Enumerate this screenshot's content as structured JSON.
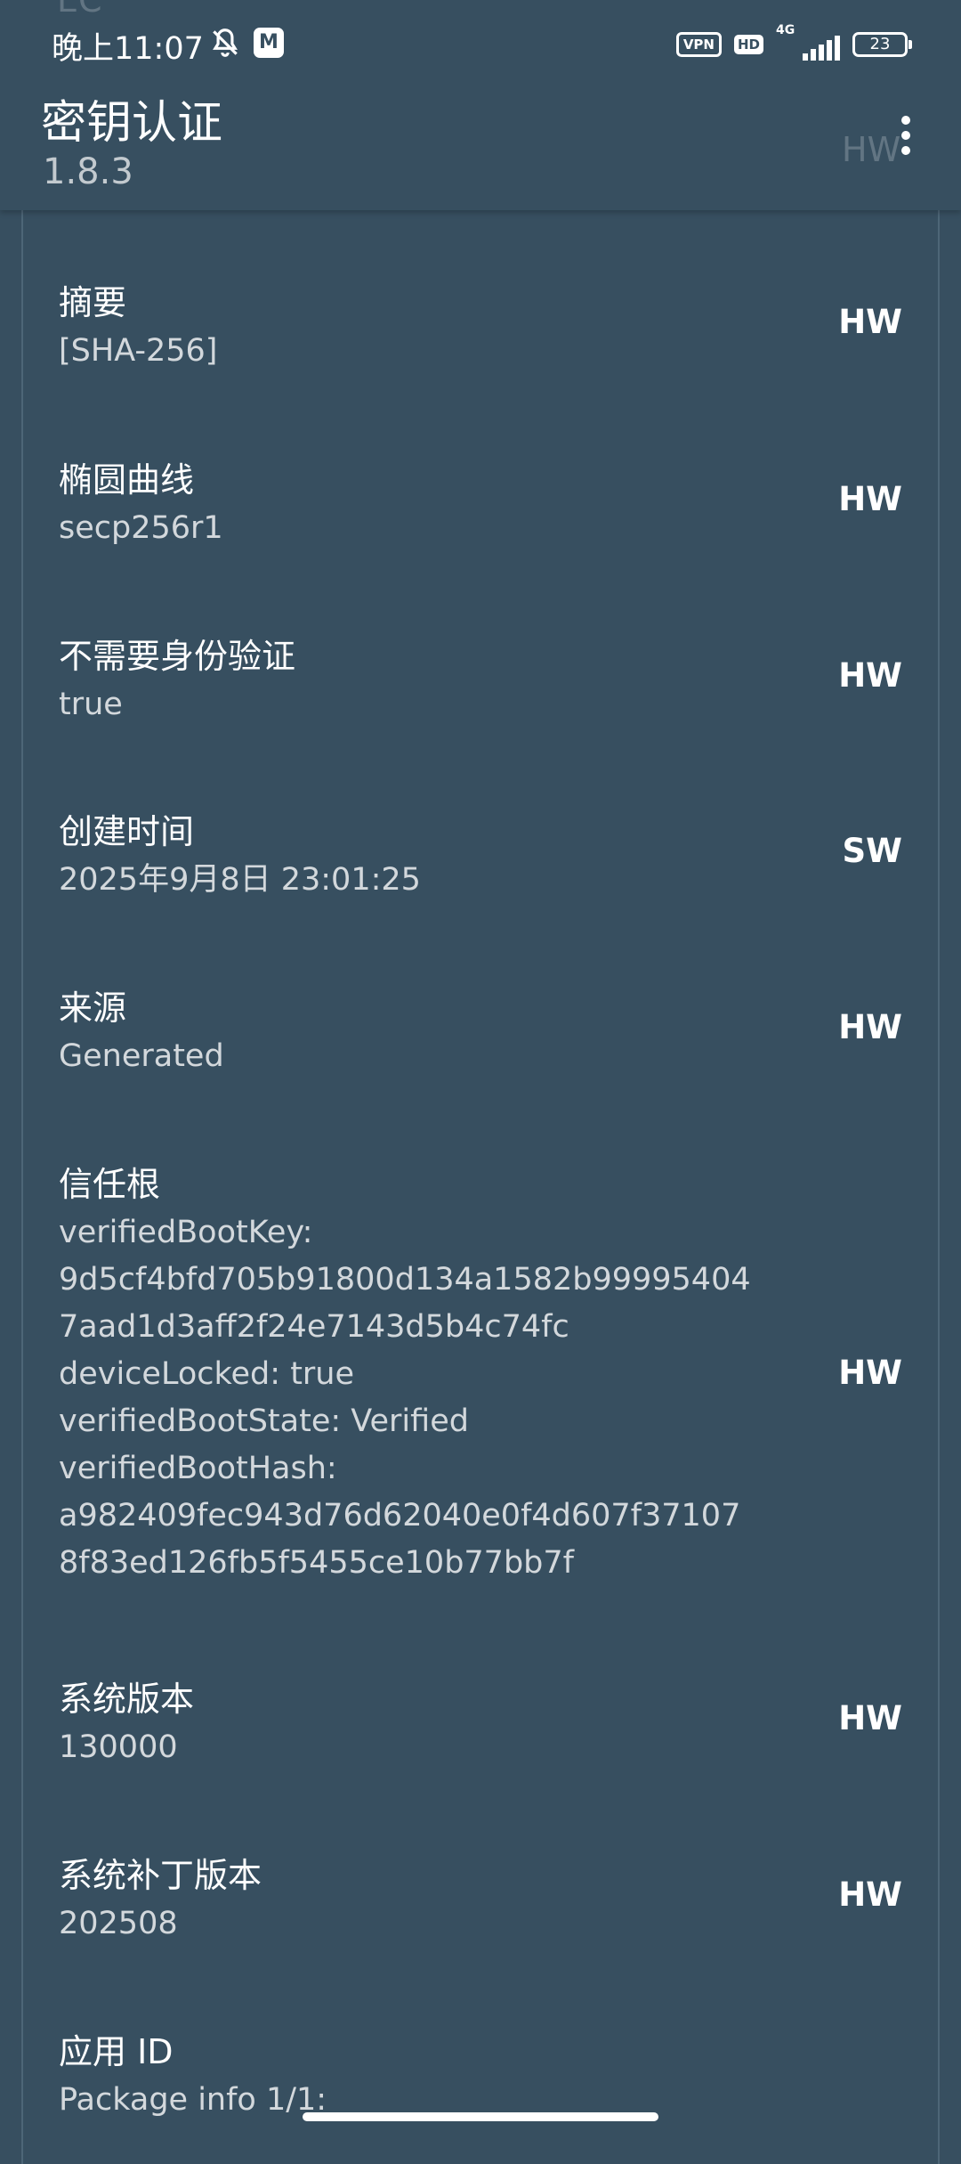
{
  "status_bar": {
    "time": "晚上11:07",
    "bell_icon": "bell-off-icon",
    "notif_letter": "M",
    "vpn": "VPN",
    "hd": "HD",
    "network": "4G",
    "battery": "23"
  },
  "app_bar": {
    "title": "密钥认证",
    "subtitle": "1.8.3",
    "menu_icon": "more-vert-icon",
    "peek_top": "EC",
    "peek_badge": "HW"
  },
  "rows": [
    {
      "label": "摘要",
      "value": "[SHA-256]",
      "badge": "HW"
    },
    {
      "label": "椭圆曲线",
      "value": "secp256r1",
      "badge": "HW"
    },
    {
      "label": "不需要身份验证",
      "value": "true",
      "badge": "HW"
    },
    {
      "label": "创建时间",
      "value": "2025年9月8日 23:01:25",
      "badge": "SW"
    },
    {
      "label": "来源",
      "value": "Generated",
      "badge": "HW"
    },
    {
      "label": "信任根",
      "value": "verifiedBootKey:\n9d5cf4bfd705b91800d134a1582b99995404\n7aad1d3aff2f24e7143d5b4c74fc\ndeviceLocked: true\nverifiedBootState: Verified\nverifiedBootHash:\na982409fec943d76d62040e0f4d607f37107\n8f83ed126fb5f5455ce10b77bb7f",
      "badge": "HW"
    },
    {
      "label": "系统版本",
      "value": "130000",
      "badge": "HW"
    },
    {
      "label": "系统补丁版本",
      "value": "202508",
      "badge": "HW"
    },
    {
      "label": "应用 ID",
      "value": "Package info 1/1:",
      "badge": ""
    }
  ]
}
